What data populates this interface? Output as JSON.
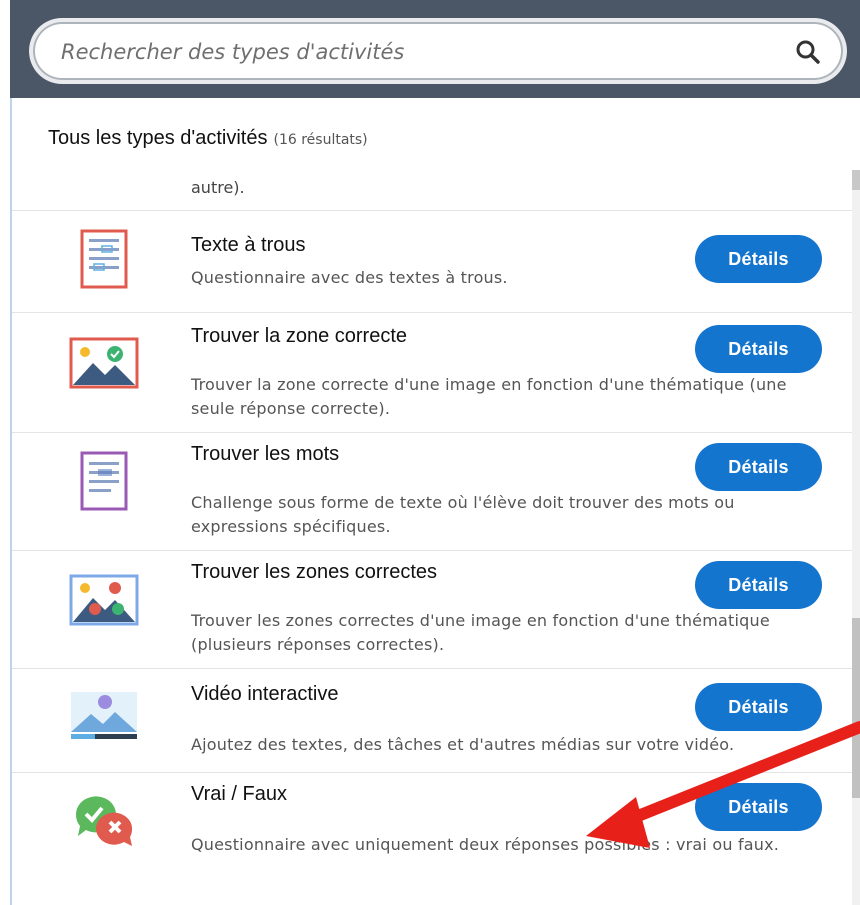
{
  "search": {
    "placeholder": "Rechercher des types d'activités"
  },
  "list_header": {
    "title": "Tous les types d'activités",
    "count": "(16 résultats)"
  },
  "fragment_text": "autre).",
  "items": [
    {
      "title": "Texte à trous",
      "description": "Questionnaire avec des textes à trous.",
      "button": "Détails",
      "icon": "fill-in-text-icon"
    },
    {
      "title": "Trouver la zone correcte",
      "description": "Trouver la zone correcte d'une image en fonction d'une thématique (une seule réponse correcte).",
      "button": "Détails",
      "icon": "image-correct-zone-icon"
    },
    {
      "title": "Trouver les mots",
      "description": "Challenge sous forme de texte où l'élève doit trouver des mots ou expressions spécifiques.",
      "button": "Détails",
      "icon": "word-search-icon"
    },
    {
      "title": "Trouver les zones correctes",
      "description": "Trouver les zones correctes d'une image en fonction d'une thématique (plusieurs réponses correctes).",
      "button": "Détails",
      "icon": "image-multiple-zones-icon"
    },
    {
      "title": "Vidéo interactive",
      "description": "Ajoutez des textes, des tâches et d'autres médias sur votre vidéo.",
      "button": "Détails",
      "icon": "interactive-video-icon"
    },
    {
      "title": "Vrai / Faux",
      "description": "Questionnaire avec uniquement deux réponses possibles : vrai ou faux.",
      "button": "Détails",
      "icon": "true-false-icon"
    }
  ],
  "colors": {
    "topbar": "#4b5666",
    "button": "#1475cf",
    "arrow": "#e8201a"
  }
}
